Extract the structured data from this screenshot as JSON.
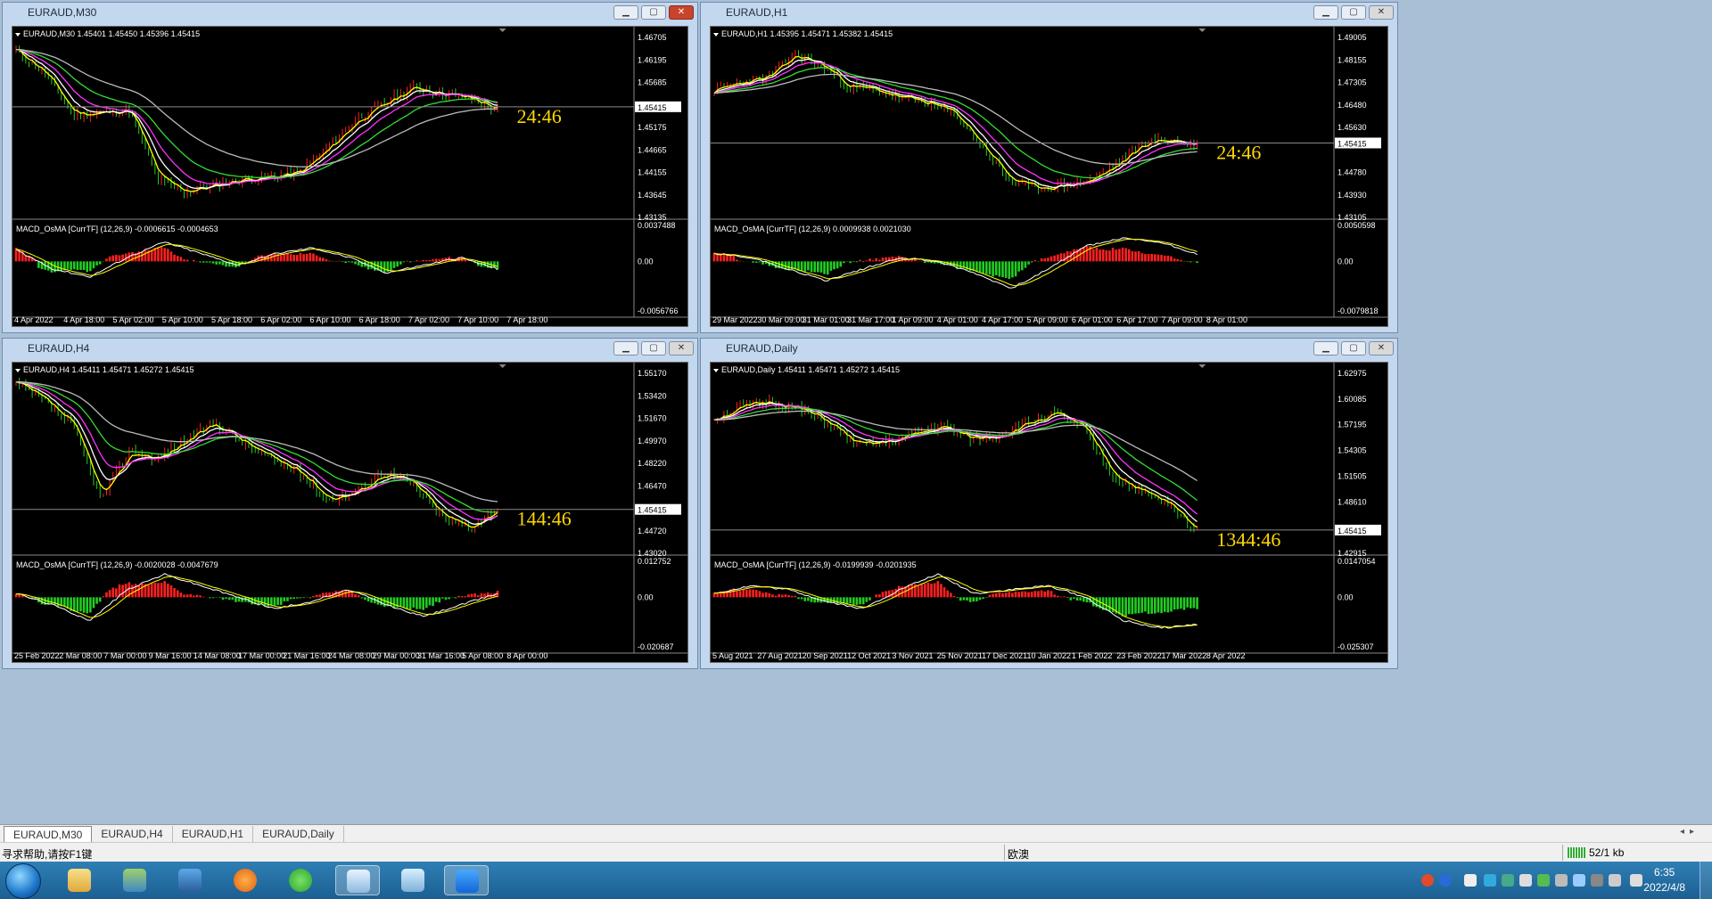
{
  "windows": [
    {
      "title": "EURAUD,M30",
      "active": true,
      "header": "EURAUD,M30  1.45401 1.45450 1.45396 1.45415",
      "price_labels": [
        "1.46705",
        "1.46195",
        "1.45685",
        "1.45415",
        "1.45175",
        "1.44665",
        "1.44155",
        "1.43645",
        "1.43135"
      ],
      "current_price": "1.45415",
      "countdown": "24:46",
      "macd_header": "MACD_OsMA [CurrTF] (12,26,9) -0.0006615 -0.0004653",
      "macd_labels": [
        "0.0037488",
        "0.00",
        "-0.0056766"
      ],
      "time_labels": [
        "4 Apr 2022",
        "4 Apr 18:00",
        "5 Apr 02:00",
        "5 Apr 10:00",
        "5 Apr 18:00",
        "6 Apr 02:00",
        "6 Apr 10:00",
        "6 Apr 18:00",
        "7 Apr 02:00",
        "7 Apr 10:00",
        "7 Apr 18:00"
      ],
      "seed": 11,
      "price_path": [
        0.94,
        0.8,
        0.55,
        0.56,
        0.58,
        0.15,
        0.08,
        0.12,
        0.16,
        0.17,
        0.2,
        0.35,
        0.52,
        0.62,
        0.72,
        0.68,
        0.65,
        0.58
      ],
      "macd_path": [
        0.3,
        -0.2,
        -0.4,
        0.1,
        0.5,
        0.2,
        -0.1,
        0.2,
        0.35,
        0.1,
        -0.3,
        -0.1,
        0.1,
        -0.2
      ]
    },
    {
      "title": "EURAUD,H1",
      "active": false,
      "header": "EURAUD,H1  1.45395 1.45471 1.45382 1.45415",
      "price_labels": [
        "1.49005",
        "1.48155",
        "1.47305",
        "1.46480",
        "1.45630",
        "1.45415",
        "1.44780",
        "1.43930",
        "1.43105"
      ],
      "current_price": "1.45415",
      "countdown": "24:46",
      "macd_header": "MACD_OsMA [CurrTF] (12,26,9) 0.0009938 0.0021030",
      "macd_labels": [
        "0.0050598",
        "0.00",
        "-0.0079818"
      ],
      "time_labels": [
        "29 Mar 2022",
        "30 Mar 09:00",
        "31 Mar 01:00",
        "31 Mar 17:00",
        "1 Apr 09:00",
        "4 Apr 01:00",
        "4 Apr 17:00",
        "5 Apr 09:00",
        "6 Apr 01:00",
        "6 Apr 17:00",
        "7 Apr 09:00",
        "8 Apr 01:00"
      ],
      "seed": 23,
      "price_path": [
        0.7,
        0.75,
        0.78,
        0.92,
        0.85,
        0.72,
        0.7,
        0.65,
        0.62,
        0.55,
        0.35,
        0.15,
        0.1,
        0.12,
        0.15,
        0.25,
        0.38,
        0.4,
        0.36
      ],
      "macd_path": [
        0.2,
        0.1,
        -0.2,
        -0.5,
        -0.2,
        0.1,
        0.0,
        -0.3,
        -0.7,
        -0.2,
        0.4,
        0.6,
        0.5,
        0.2
      ]
    },
    {
      "title": "EURAUD,H4",
      "active": false,
      "header": "EURAUD,H4  1.45411 1.45471 1.45272 1.45415",
      "price_labels": [
        "1.55170",
        "1.53420",
        "1.51670",
        "1.49970",
        "1.48220",
        "1.46470",
        "1.45415",
        "1.44720",
        "1.43020"
      ],
      "current_price": "1.45415",
      "countdown": "144:46",
      "macd_header": "MACD_OsMA [CurrTF] (12,26,9) -0.0020028 -0.0047679",
      "macd_labels": [
        "0.012752",
        "0.00",
        "-0.020687"
      ],
      "time_labels": [
        "25 Feb 2022",
        "2 Mar 08:00",
        "7 Mar 00:00",
        "9 Mar 16:00",
        "14 Mar 08:00",
        "17 Mar 00:00",
        "21 Mar 16:00",
        "24 Mar 08:00",
        "29 Mar 00:00",
        "31 Mar 16:00",
        "5 Apr 08:00",
        "8 Apr 00:00"
      ],
      "seed": 37,
      "price_path": [
        0.96,
        0.85,
        0.7,
        0.25,
        0.55,
        0.5,
        0.62,
        0.72,
        0.6,
        0.5,
        0.42,
        0.25,
        0.3,
        0.42,
        0.35,
        0.15,
        0.08,
        0.2
      ],
      "macd_path": [
        0.1,
        -0.2,
        -0.6,
        0.2,
        0.6,
        0.3,
        0.0,
        -0.3,
        -0.1,
        0.2,
        -0.2,
        -0.5,
        -0.2,
        0.1
      ]
    },
    {
      "title": "EURAUD,Daily",
      "active": false,
      "header": "EURAUD,Daily  1.45411 1.45471 1.45272 1.45415",
      "price_labels": [
        "1.62975",
        "1.60085",
        "1.57195",
        "1.54305",
        "1.51505",
        "1.48610",
        "1.45415",
        "1.42915"
      ],
      "current_price": "1.45415",
      "countdown": "1344:46",
      "macd_header": "MACD_OsMA [CurrTF] (12,26,9) -0.0199939 -0.0201935",
      "macd_labels": [
        "0.0147054",
        "0.00",
        "-0.025307"
      ],
      "time_labels": [
        "5 Aug 2021",
        "27 Aug 2021",
        "20 Sep 2021",
        "12 Oct 2021",
        "3 Nov 2021",
        "25 Nov 2021",
        "17 Dec 2021",
        "10 Jan 2022",
        "1 Feb 2022",
        "23 Feb 2022",
        "17 Mar 2022",
        "8 Apr 2022"
      ],
      "seed": 51,
      "price_path": [
        0.75,
        0.82,
        0.85,
        0.8,
        0.72,
        0.58,
        0.6,
        0.65,
        0.7,
        0.62,
        0.64,
        0.72,
        0.78,
        0.68,
        0.4,
        0.3,
        0.22,
        0.05
      ],
      "macd_path": [
        0.1,
        0.3,
        0.2,
        -0.1,
        -0.3,
        0.2,
        0.6,
        0.1,
        0.2,
        0.3,
        0.0,
        -0.6,
        -0.8,
        -0.7
      ]
    }
  ],
  "tabs": [
    "EURAUD,M30",
    "EURAUD,H4",
    "EURAUD,H1",
    "EURAUD,Daily"
  ],
  "active_tab": 0,
  "status": {
    "help": "寻求帮助,请按F1键",
    "profile": "欧澳",
    "connection": "52/1 kb"
  },
  "clock": {
    "time": "6:35",
    "date": "2022/4/8"
  },
  "colors": {
    "bull": "#ff2020",
    "bear": "#22cc22",
    "countdown": "#ffd800",
    "ma_yellow": "#ffff00",
    "ma_white": "#ffffff",
    "ma_magenta": "#ff33ff",
    "ma_green": "#33dd33",
    "ma_gray": "#bbbbbb"
  },
  "taskbar_icons": [
    "start-orb",
    "folder-icon",
    "chat-app-icon",
    "monitor-icon",
    "bird-app-icon",
    "wechat-icon",
    "mt4-terminal-icon",
    "notepad-icon",
    "notes-icon"
  ]
}
